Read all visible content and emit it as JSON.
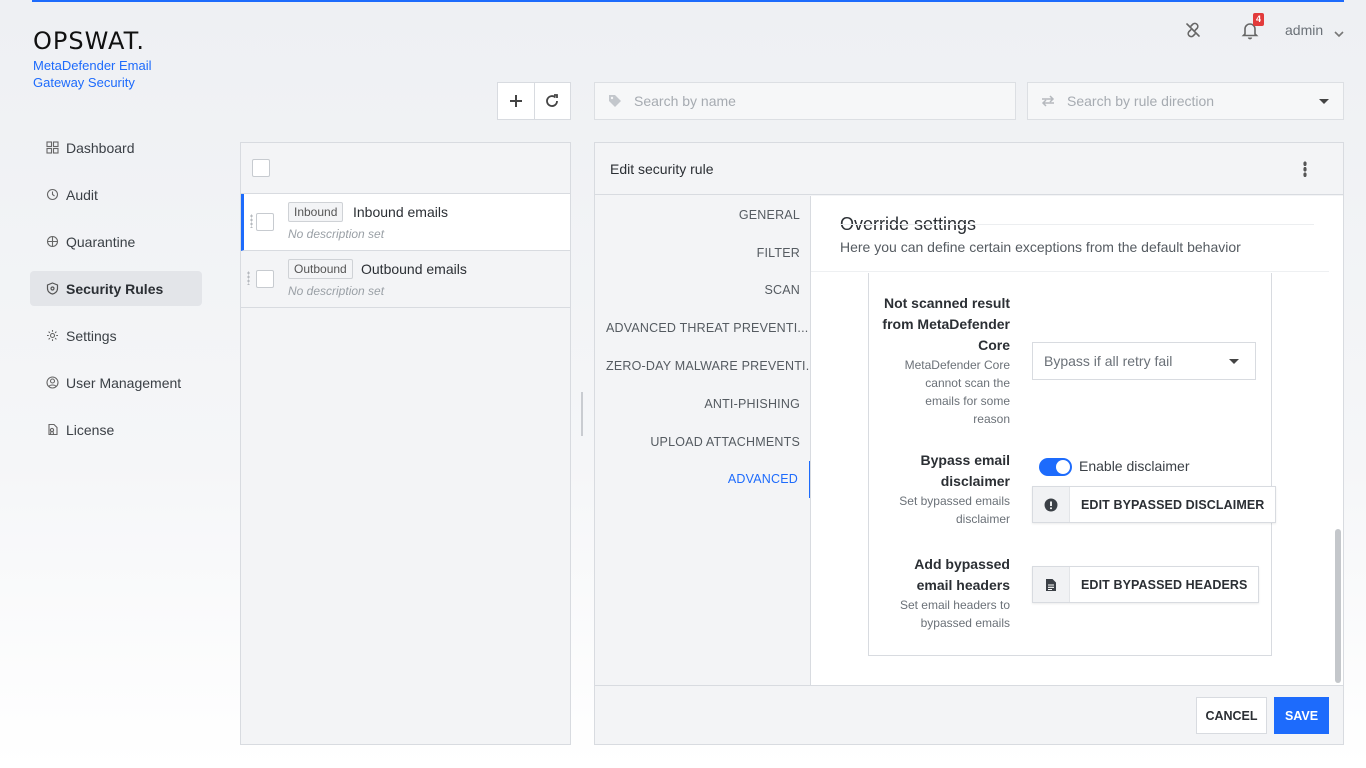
{
  "brand": {
    "logo": "OPSWAT.",
    "product_line1": "MetaDefender Email",
    "product_line2": "Gateway Security",
    "accent": "#1d6bfc"
  },
  "header": {
    "notifications_count": "4",
    "user": "admin",
    "icons": [
      "unlink-icon",
      "bell-icon",
      "chevron-down-icon"
    ]
  },
  "sidebar": {
    "items": [
      {
        "label": "Dashboard",
        "icon": "dashboard-icon"
      },
      {
        "label": "Audit",
        "icon": "audit-icon"
      },
      {
        "label": "Quarantine",
        "icon": "quarantine-icon"
      },
      {
        "label": "Security Rules",
        "icon": "shield-icon",
        "active": true
      },
      {
        "label": "Settings",
        "icon": "gear-icon"
      },
      {
        "label": "User Management",
        "icon": "user-icon"
      },
      {
        "label": "License",
        "icon": "license-icon"
      }
    ]
  },
  "search": {
    "name_placeholder": "Search by name",
    "direction_placeholder": "Search by rule direction"
  },
  "rules": [
    {
      "tag": "Inbound",
      "name": "Inbound emails",
      "description": "No description set",
      "selected": true
    },
    {
      "tag": "Outbound",
      "name": "Outbound emails",
      "description": "No description set",
      "selected": false
    }
  ],
  "editor": {
    "title": "Edit security rule",
    "tabs": [
      "GENERAL",
      "FILTER",
      "SCAN",
      "ADVANCED THREAT PREVENTI...",
      "ZERO-DAY MALWARE PREVENTI...",
      "ANTI-PHISHING",
      "UPLOAD ATTACHMENTS",
      "ADVANCED"
    ],
    "active_tab": "ADVANCED",
    "section_title": "Override settings",
    "section_subtitle": "Here you can define certain exceptions from the default behavior",
    "fields": {
      "not_scanned": {
        "label_l1": "Not scanned result",
        "label_l2": "from MetaDefender",
        "label_l3": "Core",
        "desc_l1": "MetaDefender Core",
        "desc_l2": "cannot scan the",
        "desc_l3": "emails for some",
        "desc_l4": "reason",
        "value": "Bypass if all retry fail"
      },
      "bypass_disclaimer": {
        "label_l1": "Bypass email",
        "label_l2": "disclaimer",
        "desc_l1": "Set bypassed emails",
        "desc_l2": "disclaimer",
        "toggle_label": "Enable disclaimer",
        "toggle_on": true,
        "button": "EDIT BYPASSED DISCLAIMER"
      },
      "bypass_headers": {
        "label_l1": "Add bypassed",
        "label_l2": "email headers",
        "desc_l1": "Set email headers to",
        "desc_l2": "bypassed emails",
        "button": "EDIT BYPASSED HEADERS"
      }
    },
    "cancel": "CANCEL",
    "save": "SAVE"
  }
}
